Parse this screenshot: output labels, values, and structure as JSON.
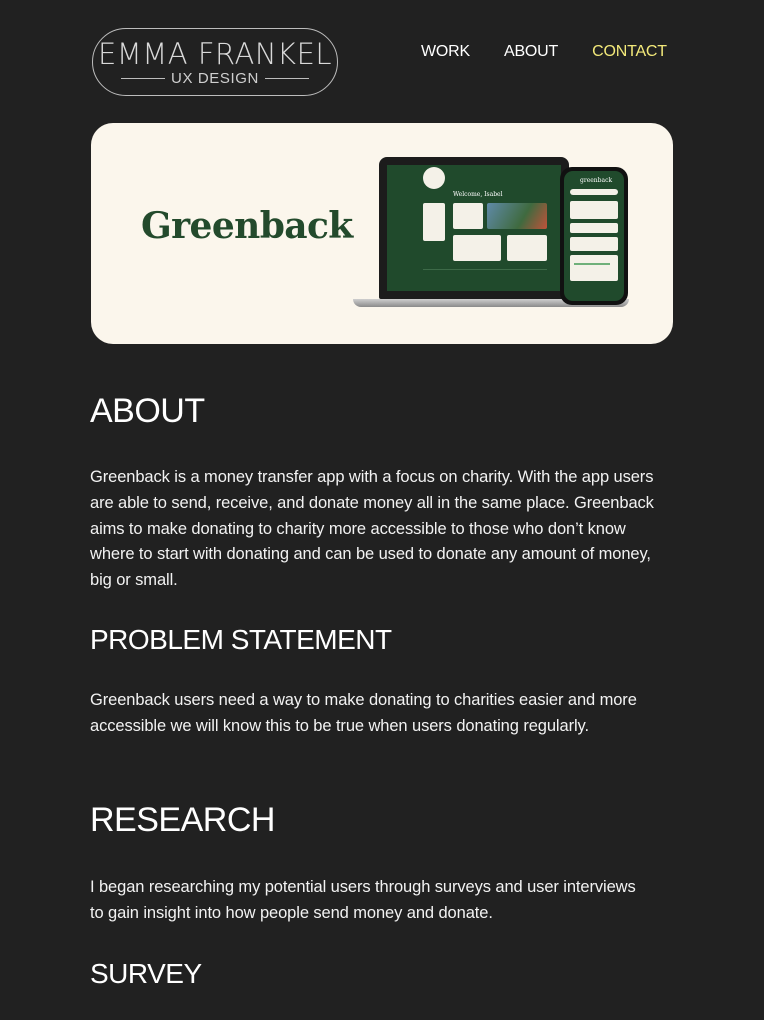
{
  "header": {
    "logo": {
      "name": "EMMA FRANKEL",
      "subtitle": "UX DESIGN"
    },
    "nav": [
      {
        "label": "WORK"
      },
      {
        "label": "ABOUT"
      },
      {
        "label": "CONTACT"
      }
    ]
  },
  "hero": {
    "brand": "Greenback",
    "laptop_screen": {
      "welcome": "Welcome, Isabel"
    },
    "phone_screen": {
      "logo": "greenback"
    }
  },
  "sections": {
    "about": {
      "heading": "ABOUT",
      "body": "Greenback is a money transfer app with a focus on charity. With the app users are able to send, receive, and donate money all in the same place. Greenback aims to make donating to charity more accessible to those who don’t know where to start with donating and can be used to donate any amount of money, big or small."
    },
    "problem": {
      "heading": "PROBLEM STATEMENT",
      "body": "Greenback users need a way to make donating to charities easier and more accessible we will know this to be true when users donating regularly."
    },
    "research": {
      "heading": "RESEARCH",
      "body": "I began researching my potential users through surveys and user interviews to gain insight into how people send money and donate."
    },
    "survey": {
      "heading": "SURVEY"
    }
  },
  "colors": {
    "background": "#212121",
    "accent_nav_active": "#f3e97a",
    "hero_background": "#fbf6ec",
    "brand_green": "#234a2c"
  }
}
